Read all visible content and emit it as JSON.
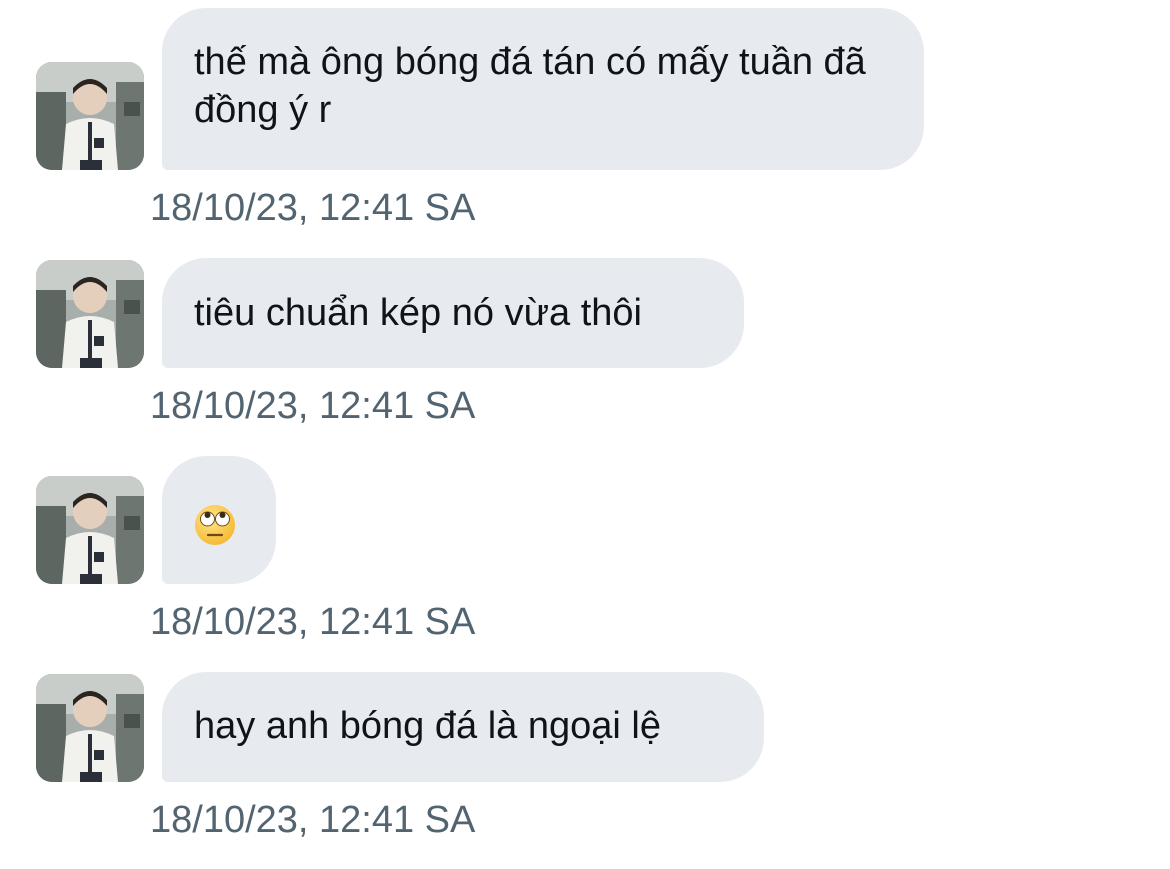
{
  "messages": [
    {
      "text": "thế mà ông bóng đá tán có mấy tuần đã đồng ý r",
      "timestamp": "18/10/23, 12:41 SA"
    },
    {
      "text": "tiêu chuẩn kép nó vừa thôi",
      "timestamp": "18/10/23, 12:41 SA"
    },
    {
      "text": "",
      "emoji": "face-with-rolling-eyes",
      "timestamp": "18/10/23, 12:41 SA"
    },
    {
      "text": "hay anh bóng đá là ngoại lệ",
      "timestamp": "18/10/23, 12:41 SA"
    }
  ],
  "colors": {
    "bubble_bg": "#e7ebef",
    "text": "#0f1419",
    "timestamp": "#536471"
  }
}
